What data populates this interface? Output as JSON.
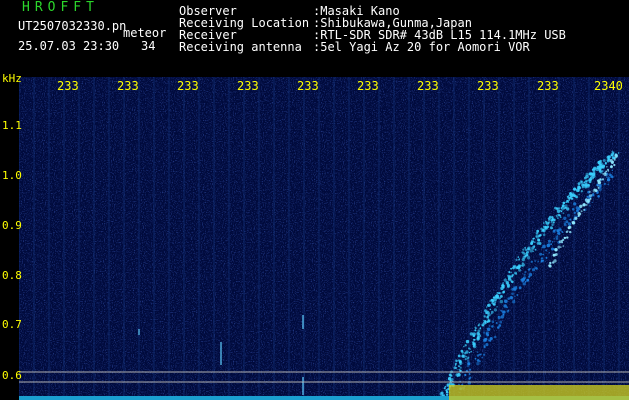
{
  "header": {
    "app_title": "HROFFT",
    "filename": "UT2507032330.pn",
    "meteor_label": "meteor",
    "datetime": "25.07.03 23:30",
    "meteor_count": "34"
  },
  "info": [
    {
      "label": "Observer",
      "value": ":Masaki Kano"
    },
    {
      "label": "Receiving Location",
      "value": ":Shibukawa,Gunma,Japan"
    },
    {
      "label": "Receiver",
      "value": ":RTL-SDR SDR# 43dB L15 114.1MHz USB"
    },
    {
      "label": "Receiving antenna",
      "value": ":5el Yagi Az 20 for Aomori VOR"
    }
  ],
  "axis": {
    "y_unit": "kHz",
    "y_ticks": [
      "1.1",
      "1.0",
      "0.9",
      "0.8",
      "0.7",
      "0.6"
    ],
    "x_ticks": [
      "233",
      "233",
      "233",
      "233",
      "233",
      "233",
      "233",
      "233",
      "233",
      "2340"
    ]
  },
  "colors": {
    "background": "#000000",
    "plot_background": "#000a3c",
    "grid": "#0a2a6a",
    "signal": "#3ad0ff",
    "text_white": "#ffffff",
    "text_yellow": "#ffff00",
    "title_green": "#2bd62b"
  }
}
